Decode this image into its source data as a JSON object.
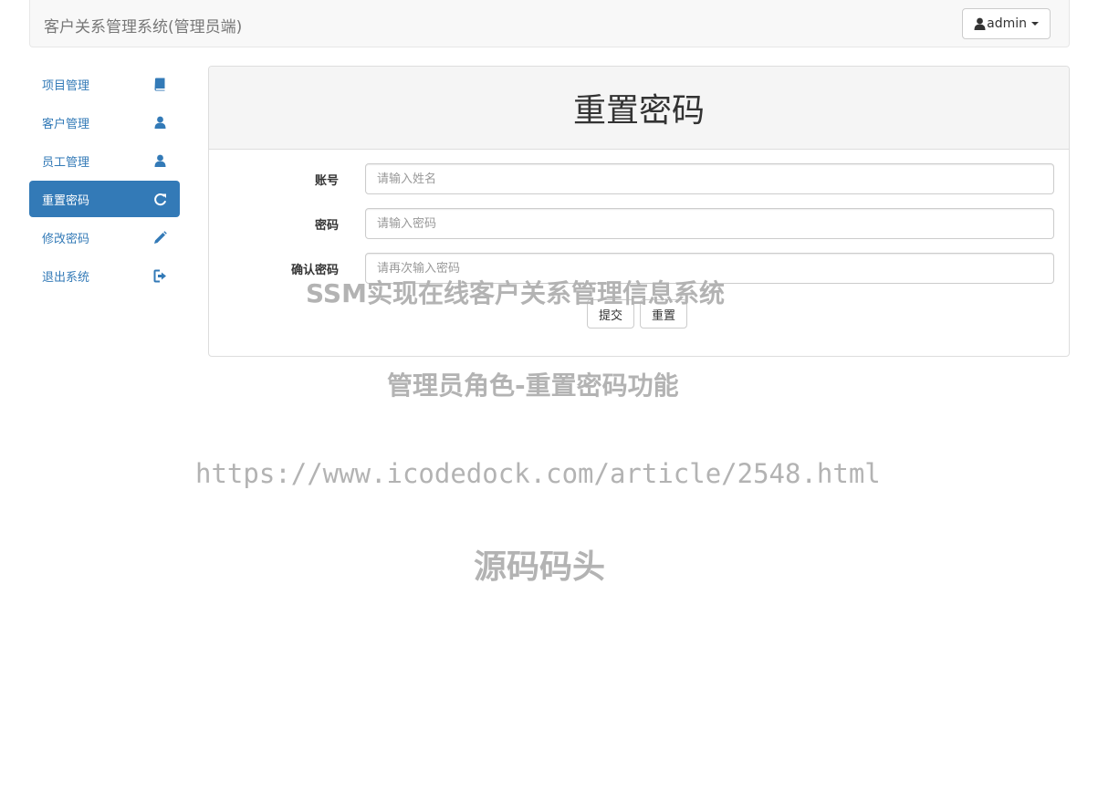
{
  "header": {
    "brand": "客户关系管理系统(管理员端)",
    "user_label": "admin"
  },
  "sidebar": {
    "items": [
      {
        "label": "项目管理",
        "icon": "book-icon",
        "active": false
      },
      {
        "label": "客户管理",
        "icon": "user-icon",
        "active": false
      },
      {
        "label": "员工管理",
        "icon": "user-icon",
        "active": false
      },
      {
        "label": "重置密码",
        "icon": "refresh-icon",
        "active": true
      },
      {
        "label": "修改密码",
        "icon": "pencil-icon",
        "active": false
      },
      {
        "label": "退出系统",
        "icon": "logout-icon",
        "active": false
      }
    ]
  },
  "form": {
    "title": "重置密码",
    "fields": [
      {
        "label": "账号",
        "placeholder": "请输入姓名"
      },
      {
        "label": "密码",
        "placeholder": "请输入密码"
      },
      {
        "label": "确认密码",
        "placeholder": "请再次输入密码"
      }
    ],
    "submit_label": "提交",
    "reset_label": "重置"
  },
  "watermark": {
    "line1": "SSM实现在线客户关系管理信息系统",
    "line2": "管理员角色-重置密码功能",
    "line3": "https://www.icodedock.com/article/2548.html",
    "line4": "源码码头"
  },
  "colors": {
    "accent": "#337ab7",
    "navbar_bg": "#f8f8f8",
    "panel_heading_bg": "#f5f5f5",
    "watermark": "#b3b3b3"
  }
}
